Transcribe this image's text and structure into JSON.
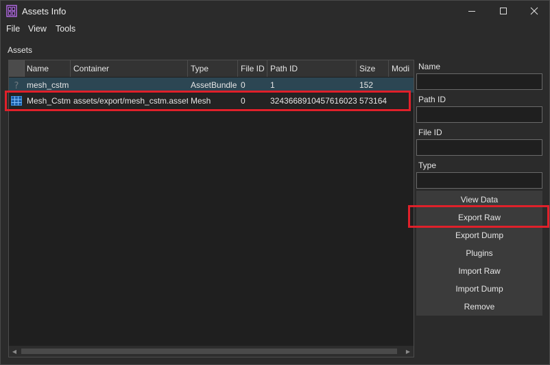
{
  "window": {
    "title": "Assets Info"
  },
  "menu": [
    "File",
    "View",
    "Tools"
  ],
  "assets_label": "Assets",
  "grid": {
    "columns": [
      "Name",
      "Container",
      "Type",
      "File ID",
      "Path ID",
      "Size",
      "Modi"
    ],
    "rows": [
      {
        "icon": "question-mark-icon",
        "name": "mesh_cstm",
        "container": "",
        "type": "AssetBundle",
        "file_id": "0",
        "path_id": "1",
        "size": "152",
        "modified": ""
      },
      {
        "icon": "mesh-grid-icon",
        "name": "Mesh_Cstm",
        "container": "assets/export/mesh_cstm.asset",
        "type": "Mesh",
        "file_id": "0",
        "path_id": "3243668910457616023",
        "size": "573164",
        "modified": ""
      }
    ]
  },
  "fields": {
    "name": {
      "label": "Name",
      "value": ""
    },
    "path_id": {
      "label": "Path ID",
      "value": ""
    },
    "file_id": {
      "label": "File ID",
      "value": ""
    },
    "type": {
      "label": "Type",
      "value": ""
    }
  },
  "actions": [
    "View Data",
    "Export Raw",
    "Export Dump",
    "Plugins",
    "Import Raw",
    "Import Dump",
    "Remove"
  ],
  "colors": {
    "highlight": "#e0202a",
    "selected_row": "#2c4653",
    "mesh_icon": "#3a8fe0",
    "app_icon": "#b06be0"
  }
}
